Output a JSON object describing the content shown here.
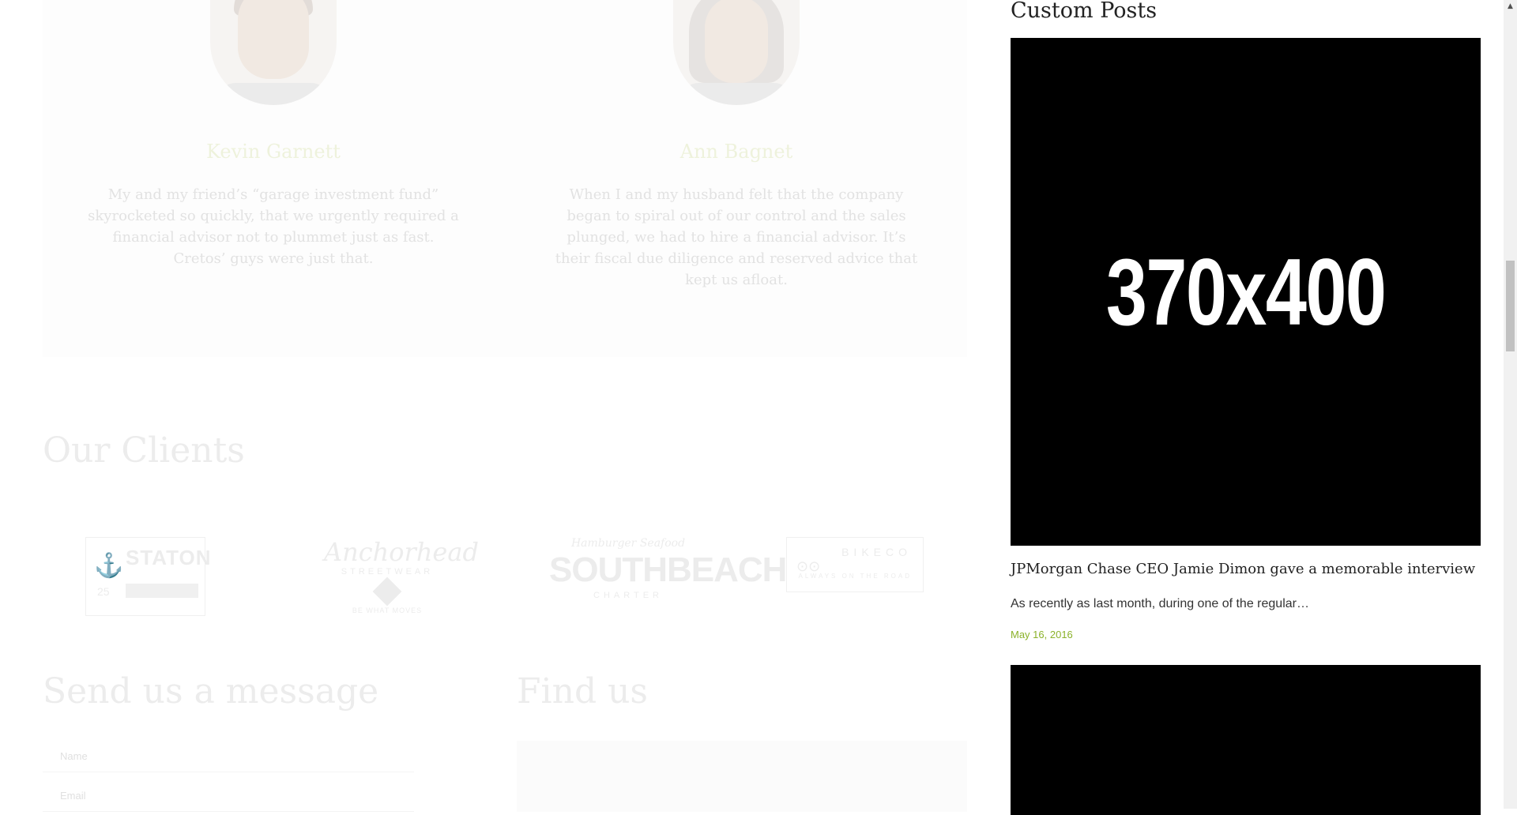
{
  "testimonials": [
    {
      "name": "Kevin Garnett",
      "quote": "My and my friend’s “garage investment fund” skyrocketed so quickly, that we urgently required a financial advisor not to plummet just as fast. Cretos’ guys were just that."
    },
    {
      "name": "Ann Bagnet",
      "quote": "When I and my husband felt that the company began to spiral out of our control and the sales plunged, we had to hire a financial advisor. It’s their fiscal due diligence and reserved advice that kept us afloat."
    }
  ],
  "clients": {
    "title": "Our Clients",
    "logos": {
      "staton": "STATON",
      "staton_year": "25",
      "anchorhead": "Anchorhead",
      "anchorhead_sub": "STREETWEAR",
      "anchorhead_tag": "BE WHAT MOVES",
      "southbeach_top": "Hamburger Seafood",
      "southbeach": "SOUTHBEACH",
      "southbeach_sub": "CHARTER",
      "bikeco": "BIKECO",
      "bikeco_sub": "ALWAYS ON THE ROAD"
    }
  },
  "contact": {
    "title": "Send us a message",
    "name_placeholder": "Name",
    "email_placeholder": "Email"
  },
  "find": {
    "title": "Find us"
  },
  "sidebar": {
    "title": "Custom Posts",
    "posts": [
      {
        "image_text": "370x400",
        "title": "JPMorgan Chase CEO Jamie Dimon gave a memorable interview",
        "excerpt": "As recently as last month, during one of the regular…",
        "date": "May 16, 2016"
      }
    ]
  },
  "scrollbar": {
    "up_arrow": "▲"
  }
}
